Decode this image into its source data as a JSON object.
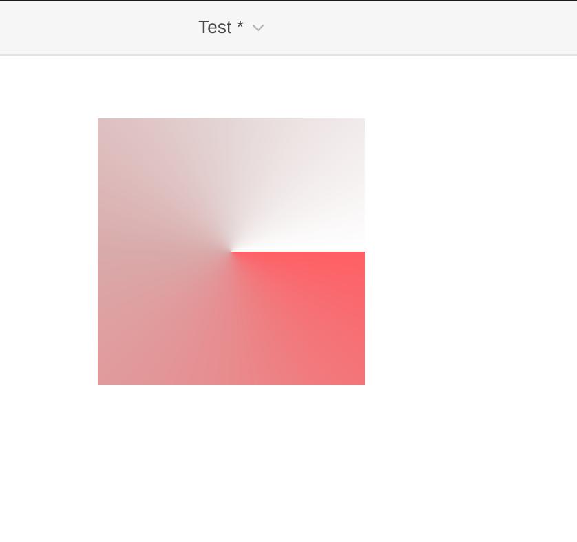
{
  "titlebar": {
    "document_title": "Test",
    "modified_marker": "*",
    "title_menu_icon": "chevron-down-icon"
  },
  "canvas": {
    "shape": "square",
    "fill": {
      "type": "conic-gradient",
      "colors": {
        "start": "#ff5f64",
        "bottom": "#e88b8e",
        "left": "#d9aaaa",
        "top": "#e4d6d6",
        "end": "#ffffff"
      }
    }
  }
}
